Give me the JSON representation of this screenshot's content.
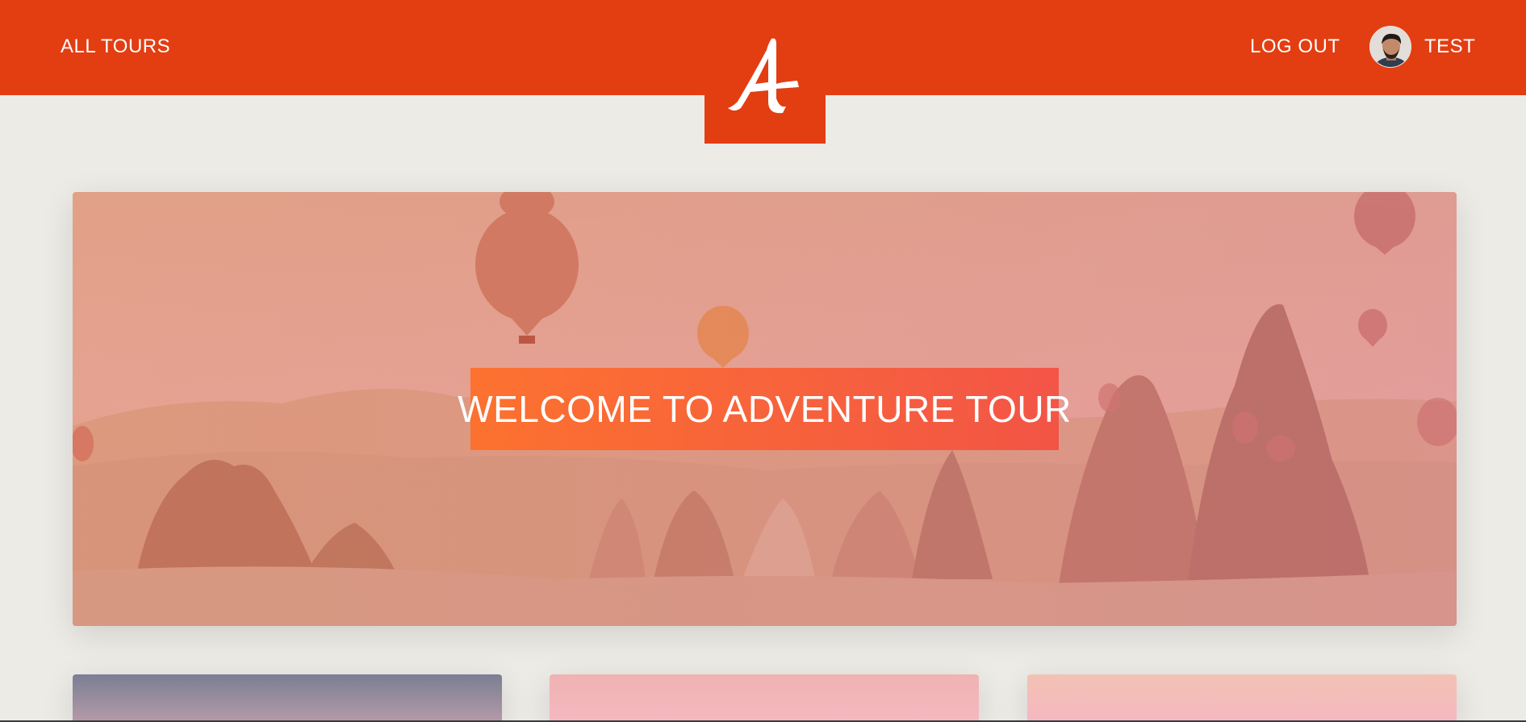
{
  "header": {
    "nav_all_tours": "ALL TOURS",
    "nav_logout": "LOG OUT",
    "user_name": "TEST",
    "logo_letter": "A"
  },
  "hero": {
    "title": "WELCOME TO ADVENTURE TOUR"
  },
  "colors": {
    "brand": "#e33d12",
    "page_background": "#edebe6",
    "text_on_brand": "#ffffff"
  },
  "icons": {
    "logo": "logo-icon",
    "avatar": "avatar"
  }
}
